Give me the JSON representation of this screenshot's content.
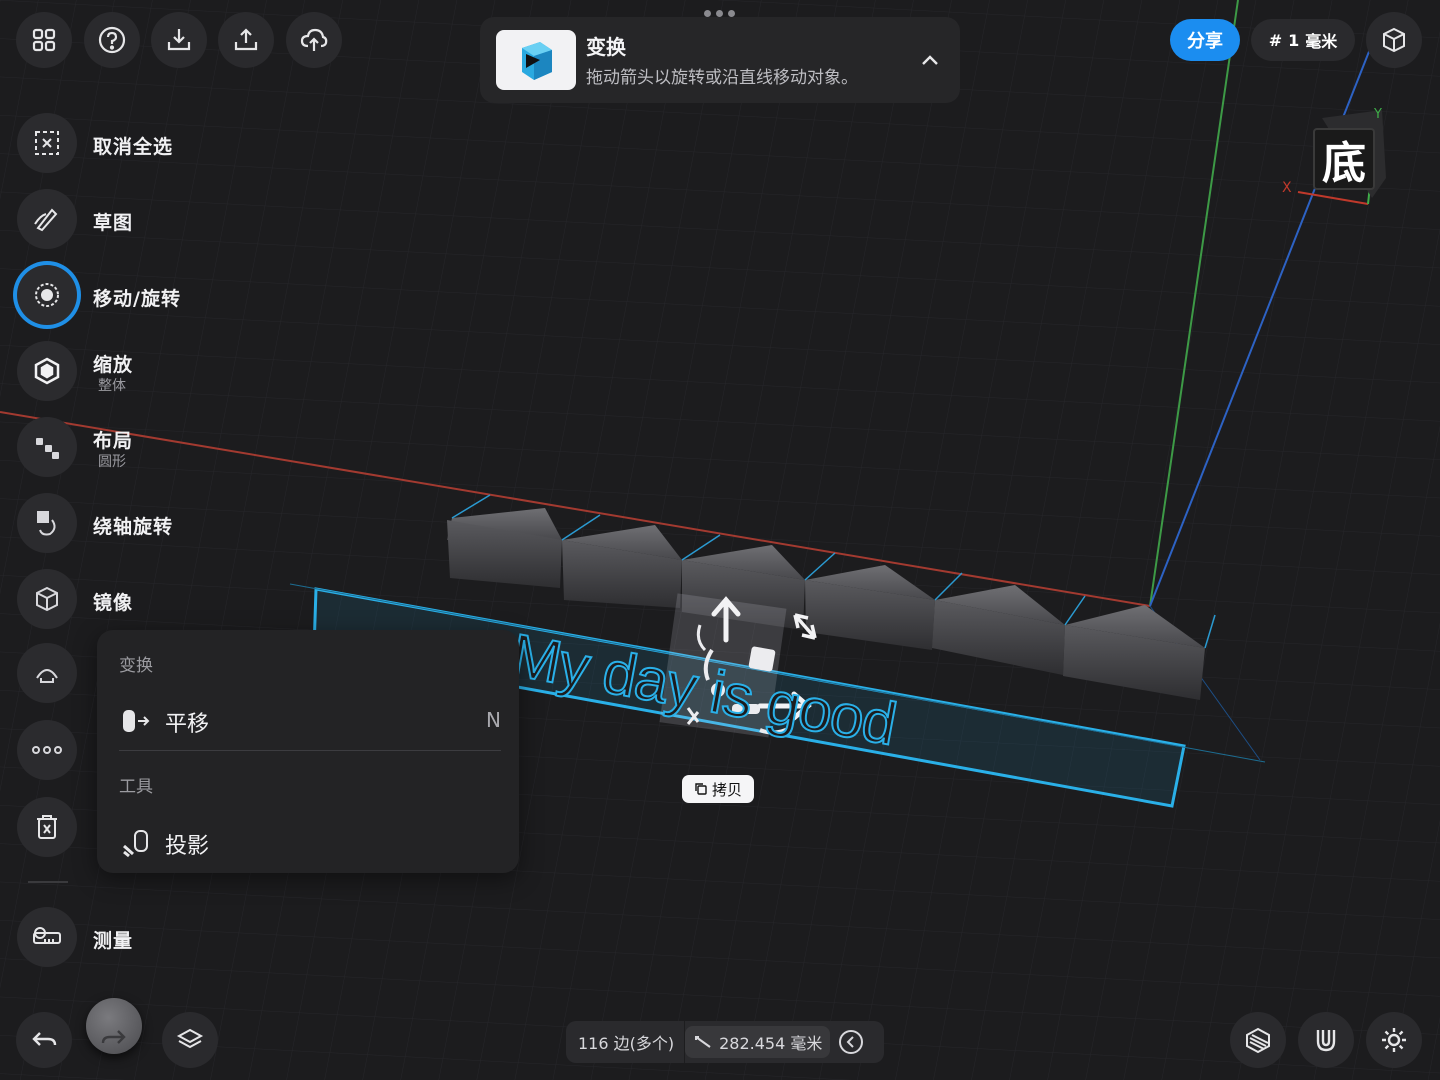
{
  "toolbar_top": {
    "icons": [
      "grid-icon",
      "help-icon",
      "import-icon",
      "export-icon",
      "cloud-upload-icon"
    ]
  },
  "hint": {
    "title": "变换",
    "text": "拖动箭头以旋转或沿直线移动对象。"
  },
  "top_right": {
    "share_label": "分享",
    "grid_symbol": "#",
    "grid_value": "1",
    "grid_unit": "毫米",
    "view_cube_face": "底",
    "axis_x": "X",
    "axis_y": "Y"
  },
  "sidebar": {
    "items": [
      {
        "label": "取消全选",
        "sub": "",
        "icon": "deselect-icon"
      },
      {
        "label": "草图",
        "sub": "",
        "icon": "sketch-icon"
      },
      {
        "label": "移动/旋转",
        "sub": "",
        "icon": "move-rotate-icon",
        "active": true
      },
      {
        "label": "缩放",
        "sub": "整体",
        "icon": "scale-icon"
      },
      {
        "label": "布局",
        "sub": "圆形",
        "icon": "layout-icon"
      },
      {
        "label": "绕轴旋转",
        "sub": "",
        "icon": "revolve-icon"
      },
      {
        "label": "镜像",
        "sub": "",
        "icon": "mirror-icon"
      },
      {
        "label": "",
        "sub": "",
        "icon": "bend-icon"
      },
      {
        "label": "",
        "sub": "",
        "icon": "more-icon"
      },
      {
        "label": "",
        "sub": "",
        "icon": "delete-icon"
      },
      {
        "label": "测量",
        "sub": "",
        "icon": "measure-icon"
      }
    ]
  },
  "popup": {
    "section1": "变换",
    "item1_label": "平移",
    "item1_shortcut": "N",
    "section2": "工具",
    "item2_label": "投影"
  },
  "scene": {
    "text_object": "My day is good",
    "copy_label": "拷贝"
  },
  "status": {
    "edges": "116 边(多个)",
    "length": "282.454 毫米"
  },
  "bottom_icons": [
    "undo-icon",
    "redo-icon",
    "layers-icon",
    "material-icon",
    "snap-icon",
    "settings-icon"
  ],
  "colors": {
    "accent": "#1b8df0",
    "selection": "#2ab0e8",
    "axis_x": "#c0392b",
    "axis_y": "#3fae49",
    "axis_z": "#2f6fd6"
  }
}
